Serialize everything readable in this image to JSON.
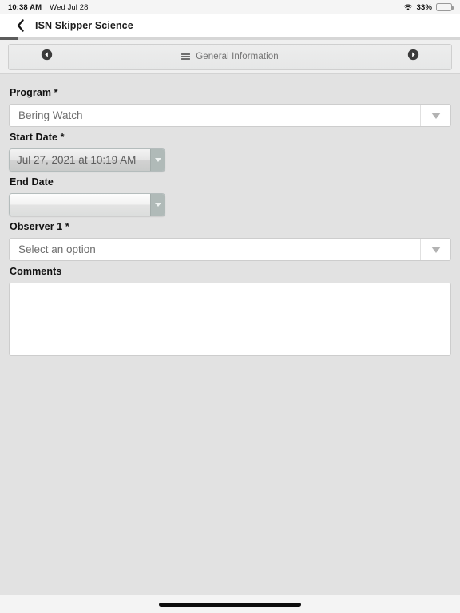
{
  "status_bar": {
    "time": "10:38 AM",
    "date": "Wed Jul 28",
    "wifi_icon": "wifi-icon",
    "battery_percent": "33%",
    "battery_level": 33,
    "battery_icon": "battery-icon"
  },
  "nav_bar": {
    "back_icon": "chevron-left-icon",
    "title": "ISN Skipper Science"
  },
  "progress": {
    "percent": 4
  },
  "toolbar": {
    "prev_icon": "circle-arrow-left-icon",
    "prev_label": "",
    "menu_icon": "hamburger-menu-icon",
    "section_label": "General Information",
    "next_icon": "circle-arrow-right-icon",
    "next_label": ""
  },
  "form": {
    "fields": [
      {
        "key": "program",
        "label": "Program *",
        "type": "select",
        "value": "Bering Watch",
        "placeholder": "Select an option",
        "caret_icon": "triangle-down-icon"
      },
      {
        "key": "start_date",
        "label": "Start Date *",
        "type": "datetime",
        "value": "Jul 27, 2021 at 10:19 AM",
        "placeholder": "",
        "caret_icon": "triangle-down-icon"
      },
      {
        "key": "end_date",
        "label": "End Date",
        "type": "datetime",
        "value": "",
        "placeholder": "",
        "caret_icon": "triangle-down-icon"
      },
      {
        "key": "observer_1",
        "label": "Observer 1 *",
        "type": "select",
        "value": "Select an option",
        "placeholder": "Select an option",
        "caret_icon": "triangle-down-icon"
      },
      {
        "key": "comments",
        "label": "Comments",
        "type": "textarea",
        "value": "",
        "placeholder": ""
      }
    ]
  },
  "home_indicator": {
    "label": "home-indicator"
  },
  "colors": {
    "page_background": "#e2e2e2",
    "nav_background": "#ffffff",
    "toolbar_background": "#efefef",
    "progress_fill": "#5c5c5c",
    "field_border": "#cdcdcd",
    "text_primary": "#111111",
    "text_muted": "#6f6f6f"
  }
}
